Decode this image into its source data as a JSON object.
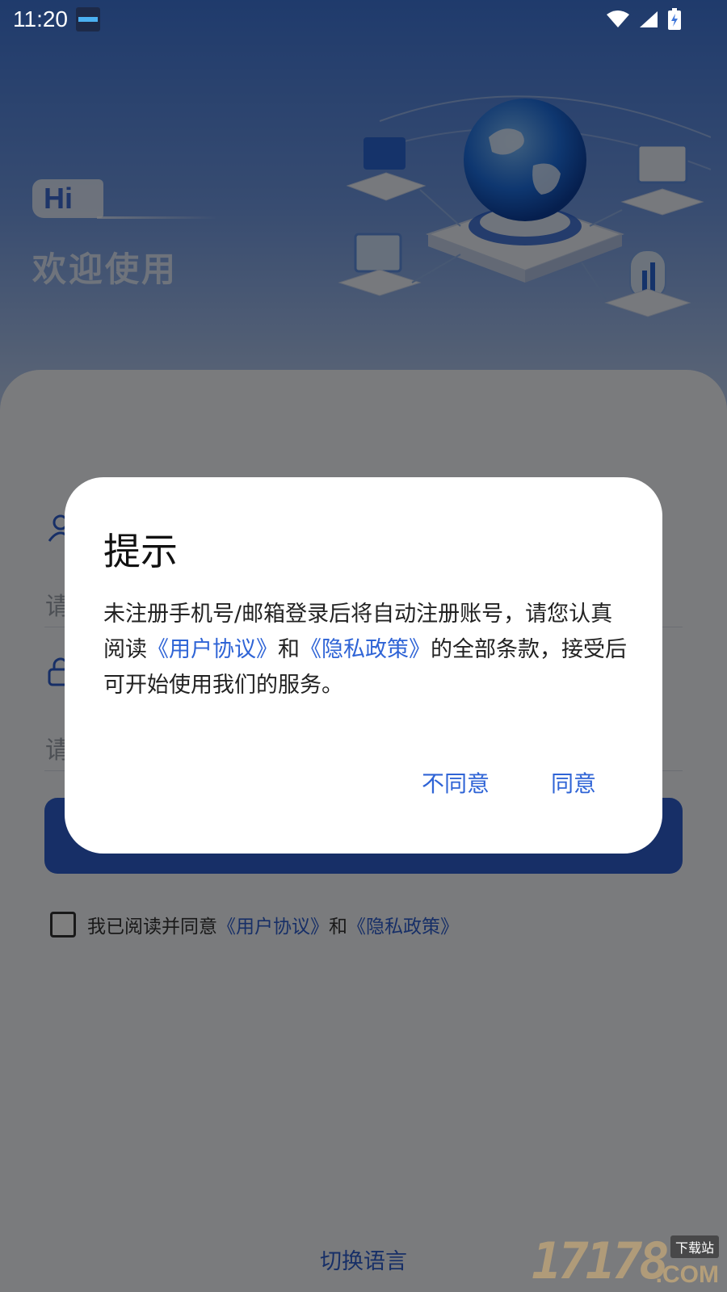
{
  "status_bar": {
    "time": "11:20",
    "icons": [
      "notification-thumbnail-icon",
      "wifi-icon",
      "signal-icon",
      "battery-charging-icon"
    ]
  },
  "hero": {
    "badge": "Hi",
    "welcome": "欢迎使用",
    "illustration": "globe-network-illustration"
  },
  "login_form": {
    "account_placeholder": "请",
    "password_placeholder": "请",
    "account_icon": "user-icon",
    "password_icon": "lock-icon",
    "agreement": {
      "prefix": "我已阅读并同意",
      "user_agreement": "《用户协议》",
      "and": "和",
      "privacy_policy": "《隐私政策》"
    },
    "switch_language": "切换语言"
  },
  "dialog": {
    "title": "提示",
    "body_part1": "未注册手机号/邮箱登录后将自动注册账号，请您认真阅读",
    "user_agreement_link": "《用户协议》",
    "and": "和",
    "privacy_policy_link": "《隐私政策》",
    "body_part2": "的全部条款，接受后可开始使用我们的服务。",
    "disagree_label": "不同意",
    "agree_label": "同意"
  },
  "watermark": {
    "number": "17178",
    "tag": "下载站",
    "suffix": ".COM"
  },
  "colors": {
    "accent": "#2f64d6",
    "hero_top": "#3f76d9",
    "overlay": "rgba(0,0,0,0.5)"
  }
}
